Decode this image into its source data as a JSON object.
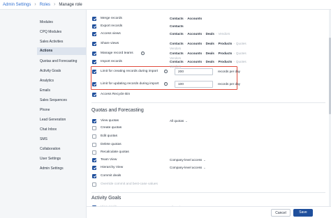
{
  "breadcrumb": {
    "root": "Admin Settings",
    "parent": "Roles",
    "current": "Manage role"
  },
  "sidebar": {
    "items": [
      {
        "label": "Modules"
      },
      {
        "label": "CPQ Modules"
      },
      {
        "label": "Sales Activities"
      },
      {
        "label": "Actions",
        "active": true
      },
      {
        "label": "Quotas and Forecasting"
      },
      {
        "label": "Activity Goals"
      },
      {
        "label": "Analytics"
      },
      {
        "label": "Emails"
      },
      {
        "label": "Sales Sequences"
      },
      {
        "label": "Phone"
      },
      {
        "label": "Lead Generation"
      },
      {
        "label": "Chat Inbox"
      },
      {
        "label": "SMS"
      },
      {
        "label": "Collaboration"
      },
      {
        "label": "User Settings"
      },
      {
        "label": "Admin Settings"
      }
    ]
  },
  "actions": {
    "rows": [
      {
        "label": "Merge records",
        "checked": true,
        "scope": [
          "Contacts",
          "Accounts"
        ]
      },
      {
        "label": "Export records",
        "checked": true,
        "scope": [
          "Contacts"
        ]
      },
      {
        "label": "Access views",
        "checked": true,
        "scope": [
          "Contacts",
          "Accounts",
          "Deals",
          "Vendors"
        ]
      },
      {
        "label": "Share views",
        "checked": true,
        "scope": [
          "Contacts",
          "Accounts",
          "Deals",
          "Products",
          "Quotes"
        ],
        "scope2": "Vendors"
      },
      {
        "label": "Manage record teams",
        "checked": true,
        "scope": [
          "Contacts",
          "Accounts",
          "Deals",
          "Products",
          "Quotes"
        ],
        "scope2": "Vendors"
      },
      {
        "label": "Import records",
        "checked": true,
        "scope": [
          "Contacts",
          "Accounts",
          "Deals",
          "Products",
          "Quotes"
        ],
        "scope2": "Vendors"
      },
      {
        "label": "Access Recycle Bin",
        "checked": true
      }
    ],
    "limits": [
      {
        "label": "Limit for creating records during import",
        "value": "200",
        "suffix": "records per day"
      },
      {
        "label": "Limit for updating records during import",
        "value": "100",
        "suffix": "records per day"
      }
    ]
  },
  "quotas": {
    "title": "Quotas and Forecasting",
    "rows": [
      {
        "label": "View quotas",
        "checked": true,
        "dropdown": "All quotas"
      },
      {
        "label": "Create quotas",
        "checked": false
      },
      {
        "label": "Edit quotas",
        "checked": false
      },
      {
        "label": "Delete quotas",
        "checked": false
      },
      {
        "label": "Recalculate quotas",
        "checked": false
      },
      {
        "label": "Team View",
        "checked": true,
        "dropdown": "Company-level access"
      },
      {
        "label": "Hierarchy View",
        "checked": true,
        "dropdown": "Company-level access"
      },
      {
        "label": "Commit deals",
        "checked": true
      },
      {
        "label": "Override commit and best-case values",
        "checked": false,
        "disabled": true
      }
    ]
  },
  "goals": {
    "title": "Activity Goals",
    "rows": [
      {
        "label": "View goals",
        "checked": true,
        "disabled": true,
        "dropdown": "All goals"
      }
    ]
  },
  "footer": {
    "cancel_label": "Cancel",
    "save_label": "Save"
  },
  "colors": {
    "accent": "#1f4f9c",
    "highlight": "#e04b3c",
    "link": "#2f6fd1"
  }
}
